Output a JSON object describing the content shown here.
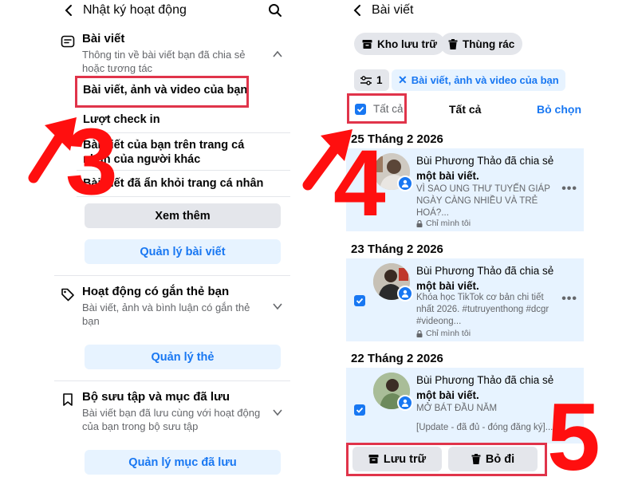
{
  "left": {
    "header": {
      "title": "Nhật ký hoạt động"
    },
    "section_posts": {
      "title": "Bài viết",
      "desc": "Thông tin về bài viết bạn đã chia sẻ hoặc tương tác",
      "items": [
        "Bài viết, ảnh và video của bạn",
        "Lượt check in",
        "Bài viết của bạn trên trang cá nhân của người khác",
        "Bài viết đã ẩn khỏi trang cá nhân"
      ],
      "see_more": "Xem thêm",
      "manage": "Quản lý bài viết"
    },
    "section_tags": {
      "title": "Hoạt động có gắn thẻ bạn",
      "desc": "Bài viết, ảnh và bình luận có gắn thẻ bạn",
      "manage": "Quản lý thẻ"
    },
    "section_saved": {
      "title": "Bộ sưu tập và mục đã lưu",
      "desc": "Bài viết bạn đã lưu cùng với hoạt động của bạn trong bộ sưu tập",
      "manage": "Quản lý mục đã lưu"
    },
    "step_label": "3"
  },
  "right": {
    "header": {
      "title": "Bài viết"
    },
    "archive_label": "Kho lưu trữ",
    "trash_label": "Thùng rác",
    "filter_count": "1",
    "filter_chip": "Bài viết, ảnh và video của bạn",
    "select_all_label": "Tất cả",
    "center_label": "Tất cả",
    "deselect_label": "Bỏ chọn",
    "groups": [
      {
        "date": "25 Tháng 2 2026",
        "title_prefix": "Bùi Phương Thảo đã chia sẻ",
        "title_bold": "một bài viết.",
        "snippet": "VÌ SAO UNG THƯ TUYẾN GIÁP NGÀY CÀNG NHIỀU VÀ TRẺ HOÁ?...",
        "privacy": "Chỉ mình tôi"
      },
      {
        "date": "23 Tháng 2 2026",
        "title_prefix": "Bùi Phương Thảo đã chia sẻ",
        "title_bold": "một bài viết.",
        "snippet": "Khóa học TikTok cơ bản chi tiết nhất 2026. #tutruyenthong #dcgr #videong...",
        "privacy": "Chỉ mình tôi"
      },
      {
        "date": "22 Tháng 2 2026",
        "title_prefix": "Bùi Phương Thảo đã chia sẻ",
        "title_bold": "một bài viết.",
        "snippet": "MỞ BÁT ĐẦU NĂM",
        "snippet2": "[Update - đã đủ - đóng đăng ký]..."
      }
    ],
    "archive_button": "Lưu trữ",
    "delete_button": "Bỏ đi",
    "step_label_top": "4",
    "step_label_bottom": "5"
  },
  "colors": {
    "accent": "#1877f2",
    "annotation_red": "#ff0f0f",
    "highlight_box": "#e0344a",
    "selected_bg": "#e7f3ff"
  }
}
